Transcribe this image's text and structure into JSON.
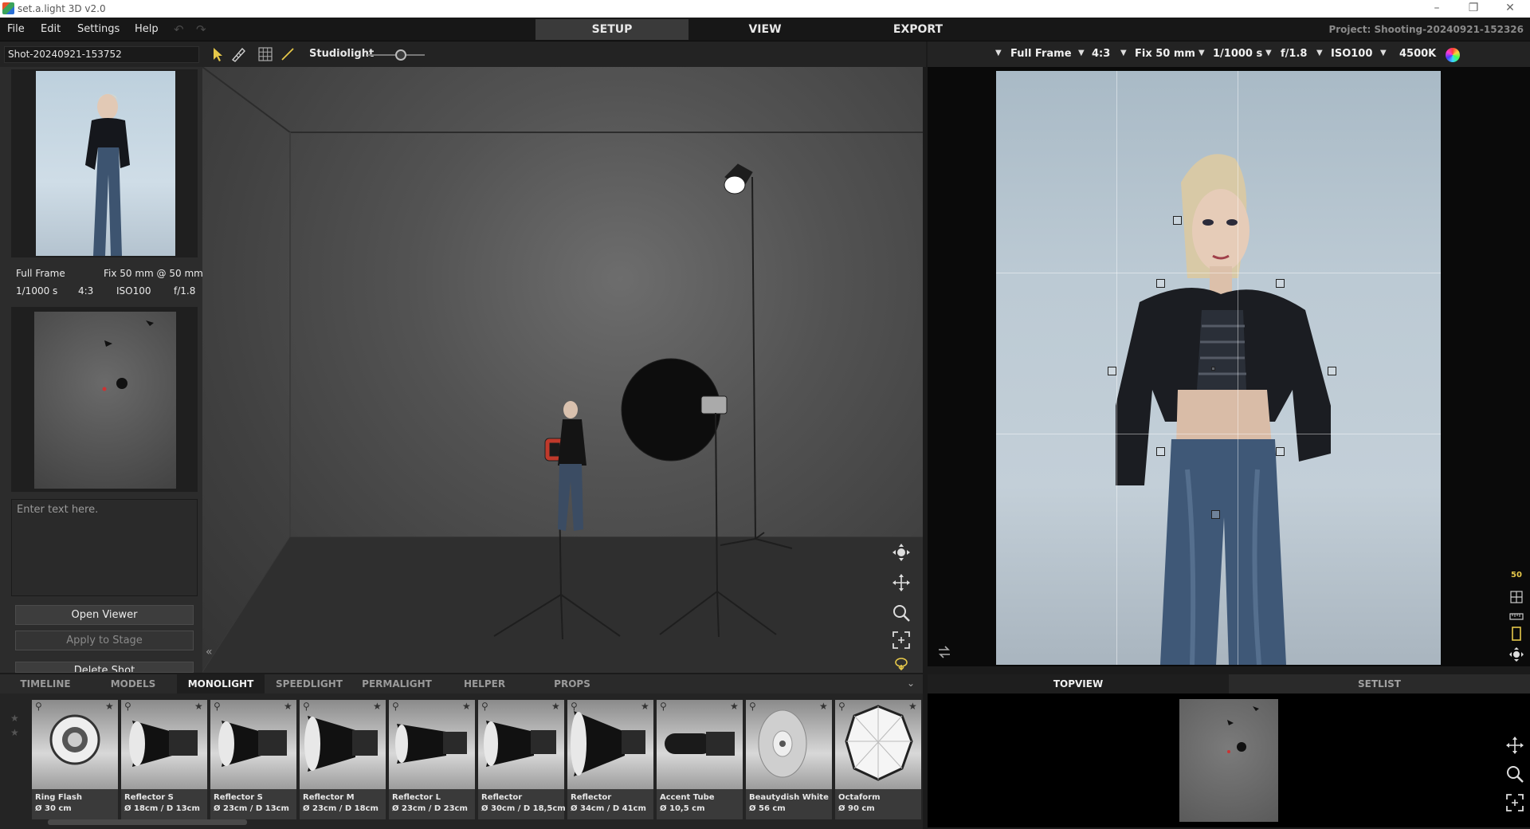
{
  "window": {
    "title": "set.a.light 3D v2.0",
    "minimize": "–",
    "maximize": "❐",
    "close": "✕"
  },
  "menu": {
    "file": "File",
    "edit": "Edit",
    "settings": "Settings",
    "help": "Help"
  },
  "main_tabs": {
    "setup": "SETUP",
    "view": "VIEW",
    "export": "EXPORT"
  },
  "project": "Project: Shooting-20240921-152326",
  "toolbar": {
    "shot_name": "Shot-20240921-153752",
    "studiolight_label": "Studiolight",
    "studiolight_level": 0.6
  },
  "camera": {
    "sensor": "Full Frame",
    "aspect": "4:3",
    "lens": "Fix 50 mm",
    "shutter": "1/1000 s",
    "aperture": "f/1.8",
    "iso": "ISO100",
    "white_balance": "4500K"
  },
  "shot_info": {
    "sensor": "Full Frame",
    "lens": "Fix 50 mm @ 50 mm",
    "shutter": "1/1000 s",
    "aspect": "4:3",
    "iso": "ISO100",
    "aperture": "f/1.8"
  },
  "notes": {
    "placeholder": "Enter text here."
  },
  "side_buttons": {
    "open_viewer": "Open Viewer",
    "apply_stage": "Apply to Stage",
    "delete_shot": "Delete Shot"
  },
  "library_tabs": [
    "TIMELINE",
    "MODELS",
    "MONOLIGHT",
    "SPEEDLIGHT",
    "PERMALIGHT",
    "HELPER",
    "PROPS"
  ],
  "library_active": "MONOLIGHT",
  "library_items": [
    {
      "name": "Ring Flash",
      "size": "Ø 30 cm"
    },
    {
      "name": "Reflector S",
      "size": "Ø 18cm / D 13cm"
    },
    {
      "name": "Reflector S",
      "size": "Ø 23cm / D 13cm"
    },
    {
      "name": "Reflector M",
      "size": "Ø 23cm / D 18cm"
    },
    {
      "name": "Reflector L",
      "size": "Ø 23cm / D 23cm"
    },
    {
      "name": "Reflector",
      "size": "Ø 30cm / D 18,5cm"
    },
    {
      "name": "Reflector",
      "size": "Ø 34cm / D 41cm"
    },
    {
      "name": "Accent Tube",
      "size": "Ø 10,5 cm"
    },
    {
      "name": "Beautydish White",
      "size": "Ø 56 cm"
    },
    {
      "name": "Octaform",
      "size": "Ø 90 cm"
    }
  ],
  "view_tabs": {
    "topview": "TOPVIEW",
    "setlist": "SETLIST"
  },
  "zoom_label": "50",
  "colors": {
    "accent_yellow": "#e6c84a",
    "active_tab": "#3a3a3a",
    "panel": "#232323"
  }
}
